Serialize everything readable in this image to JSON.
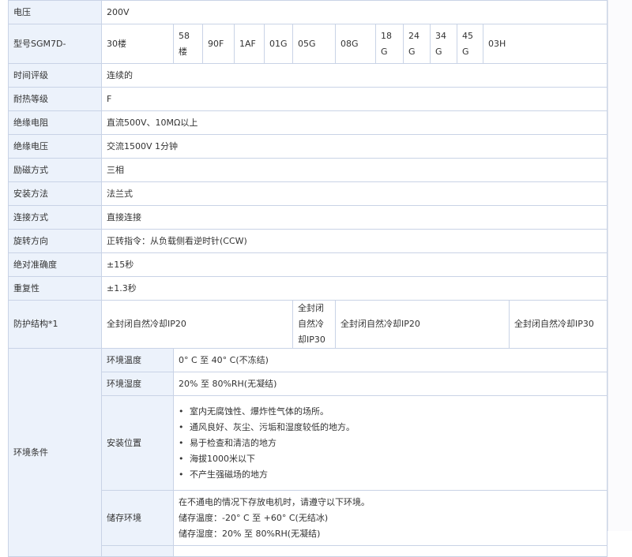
{
  "rows": {
    "voltage": {
      "label": "电压",
      "value": "200V"
    },
    "model": {
      "label": "型号SGM7D-",
      "codes": [
        "30楼",
        "58楼",
        "90F",
        "1AF",
        "01G",
        "05G",
        "08G",
        "18G",
        "24G",
        "34G",
        "45G",
        "03H"
      ]
    },
    "time_rating": {
      "label": "时间评级",
      "value": "连续的"
    },
    "heat_class": {
      "label": "耐热等级",
      "value": "F"
    },
    "insulation_resistance": {
      "label": "绝缘电阻",
      "value": "直流500V、10MΩ以上"
    },
    "insulation_voltage": {
      "label": "绝缘电压",
      "value": "交流1500V 1分钟"
    },
    "excitation": {
      "label": "励磁方式",
      "value": "三相"
    },
    "mounting": {
      "label": "安装方法",
      "value": "法兰式"
    },
    "connection": {
      "label": "连接方式",
      "value": "直接连接"
    },
    "rotation": {
      "label": "旋转方向",
      "value": "正转指令：从负载侧看逆时针(CCW)"
    },
    "accuracy": {
      "label": "绝对准确度",
      "value": "±15秒"
    },
    "repeatability": {
      "label": "重复性",
      "value": "±1.3秒"
    },
    "protection": {
      "label": "防护结构*1",
      "values": [
        "全封闭自然冷却IP20",
        "全封闭自然冷却IP30",
        "全封闭自然冷却IP20",
        "全封闭自然冷却IP30"
      ]
    }
  },
  "environment": {
    "label": "环境条件",
    "temp": {
      "label": "环境温度",
      "value": "0° C 至 40° C(不冻结)"
    },
    "humidity": {
      "label": "环境湿度",
      "value": "20% 至 80%RH(无凝结)"
    },
    "location": {
      "label": "安装位置",
      "bullet": "•",
      "items": [
        "室内无腐蚀性、爆炸性气体的场所。",
        "通风良好、灰尘、污垢和湿度较低的地方。",
        "易于检查和清洁的地方",
        "海拔1000米以下",
        "不产生强磁场的地方"
      ]
    },
    "storage": {
      "label": "储存环境",
      "lines": [
        "在不通电的情况下存放电机时，请遵守以下环境。",
        "储存温度：-20° C 至 +60° C(无结冰)",
        "储存湿度：20% 至 80%RH(无凝结)"
      ]
    }
  },
  "colors": {
    "header_bg": "#ecf2fb",
    "border": "#c9d3e6"
  }
}
